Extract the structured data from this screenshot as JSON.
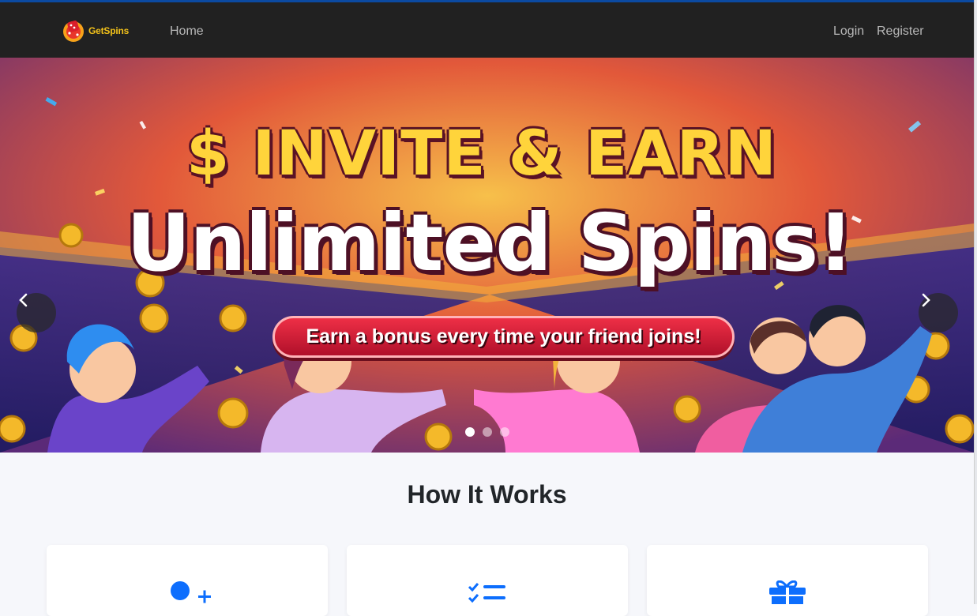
{
  "brand": {
    "name": "GetSpins",
    "logo_icon": "dice-logo-icon"
  },
  "nav": {
    "home": "Home",
    "login": "Login",
    "register": "Register"
  },
  "hero": {
    "title_line1": "$ INVITE & EARN",
    "title_line2": "Unlimited Spins!",
    "subtitle": "Earn a bonus every  time your friend joins!",
    "prev_icon": "chevron-left-icon",
    "next_icon": "chevron-right-icon",
    "slides_count": 3,
    "active_slide": 1
  },
  "how_it_works": {
    "title": "How It Works",
    "cards": [
      {
        "icon": "user-plus-icon"
      },
      {
        "icon": "checklist-icon"
      },
      {
        "icon": "gift-icon"
      }
    ]
  },
  "colors": {
    "nav_bg": "#212121",
    "accent_blue": "#0d6efd",
    "brand_yellow": "#f3c21a",
    "page_bg": "#f6f7fb"
  }
}
